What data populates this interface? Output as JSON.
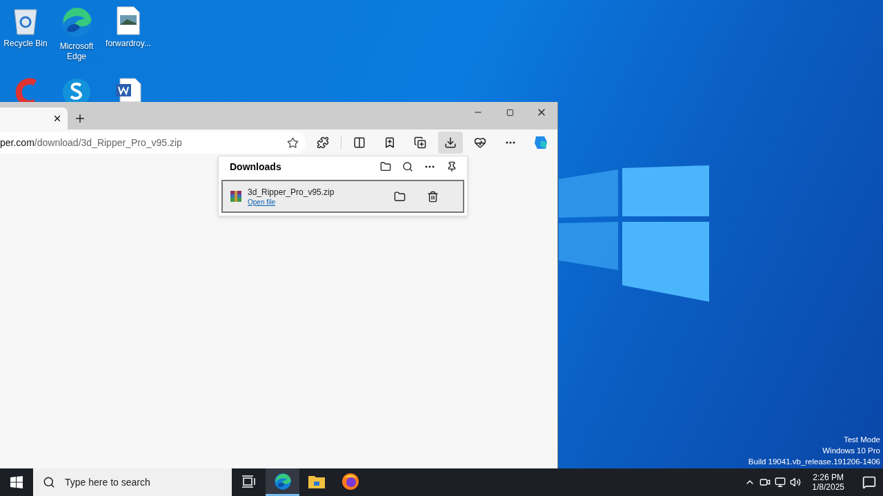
{
  "desktop_icons": [
    {
      "kind": "recycle",
      "label": "Recycle Bin"
    },
    {
      "kind": "edge",
      "label": "Microsoft Edge"
    },
    {
      "kind": "image",
      "label": "forwardroy..."
    },
    {
      "kind": "cleaner"
    },
    {
      "kind": "skype"
    },
    {
      "kind": "word"
    }
  ],
  "browser": {
    "address": {
      "host": "per.com",
      "path": "/download/3d_Ripper_Pro_v95.zip"
    },
    "toolbar": [
      {
        "kind": "extensions",
        "selected": false
      },
      {
        "kind": "split",
        "selected": false
      },
      {
        "kind": "favorites",
        "selected": false
      },
      {
        "kind": "collections",
        "selected": false
      },
      {
        "kind": "downloads",
        "selected": true
      },
      {
        "kind": "health",
        "selected": false
      },
      {
        "kind": "more",
        "selected": false
      },
      {
        "kind": "copilot",
        "selected": false
      }
    ],
    "downloads": {
      "title": "Downloads",
      "items": [
        {
          "name": "3d_Ripper_Pro_v95.zip",
          "action": "Open file",
          "selected": true
        }
      ]
    }
  },
  "system_info": [
    "Test Mode",
    "Windows 10 Pro",
    "Build 19041.vb_release.191206-1406"
  ],
  "taskbar": {
    "search": {
      "placeholder": "Type here to search"
    },
    "apps": [
      {
        "kind": "taskview",
        "active": false
      },
      {
        "kind": "edge",
        "active": true
      },
      {
        "kind": "explorer",
        "active": false
      },
      {
        "kind": "firefox",
        "active": false
      }
    ],
    "clock": {
      "time": "2:26 PM",
      "date": "1/8/2025"
    }
  }
}
